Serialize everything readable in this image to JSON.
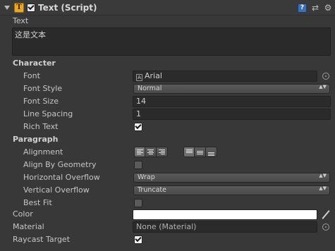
{
  "component": {
    "title": "Text (Script)",
    "enabled": true,
    "header_icons": {
      "component_icon": "text-component-icon",
      "help": "help-icon",
      "settings": "settings-icon",
      "menu": "context-menu-icon"
    },
    "help_glyph": "?",
    "settings_glyph": "⇄",
    "menu_glyph": "⚙",
    "type_glyph": "T"
  },
  "text_field": {
    "label": "Text",
    "value": "这是文本"
  },
  "character": {
    "header": "Character",
    "font": {
      "label": "Font",
      "value": "Arial",
      "icon": "font-asset-icon",
      "icon_glyph": "A"
    },
    "font_style": {
      "label": "Font Style",
      "value": "Normal"
    },
    "font_size": {
      "label": "Font Size",
      "value": "14"
    },
    "line_spacing": {
      "label": "Line Spacing",
      "value": "1"
    },
    "rich_text": {
      "label": "Rich Text",
      "checked": true
    }
  },
  "paragraph": {
    "header": "Paragraph",
    "alignment": {
      "label": "Alignment",
      "horizontal": [
        "Left",
        "Center",
        "Right"
      ],
      "horizontal_selected": "Left",
      "vertical": [
        "Top",
        "Middle",
        "Bottom"
      ],
      "vertical_selected": "Top"
    },
    "align_by_geometry": {
      "label": "Align By Geometry",
      "checked": false
    },
    "horizontal_overflow": {
      "label": "Horizontal Overflow",
      "value": "Wrap"
    },
    "vertical_overflow": {
      "label": "Vertical Overflow",
      "value": "Truncate"
    },
    "best_fit": {
      "label": "Best Fit",
      "checked": false
    }
  },
  "color": {
    "label": "Color",
    "value": "#ffffff"
  },
  "material": {
    "label": "Material",
    "value": "None (Material)"
  },
  "raycast_target": {
    "label": "Raycast Target",
    "checked": true
  },
  "dropdown_arrow_glyph": "▲▼"
}
